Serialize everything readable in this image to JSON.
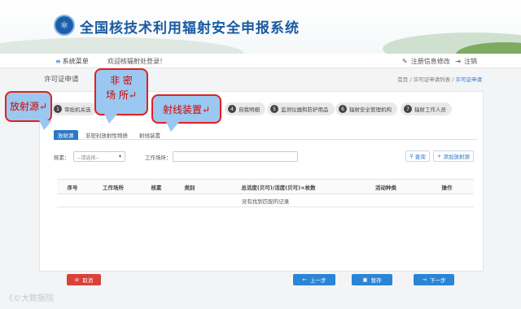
{
  "header": {
    "app_title": "全国核技术利用辐射安全申报系统",
    "logo_glyph": "⚛"
  },
  "topbar": {
    "menu_icon": "≡",
    "menu_label": "系统菜单",
    "welcome": "欢迎核辐射处登录！",
    "edit_icon": "✎",
    "edit_label": "注册信息修改",
    "logout_icon": "⇥",
    "logout_label": "注销"
  },
  "page": {
    "title": "许可证申请",
    "breadcrumb": [
      "首页",
      "/",
      "许可证申请列表",
      "/",
      "许可证申请"
    ]
  },
  "steps": [
    {
      "num": "1",
      "label": "审批机关选"
    },
    {
      "num": "4",
      "label": "自我明细"
    },
    {
      "num": "5",
      "label": "监测仪器和防护用品"
    },
    {
      "num": "6",
      "label": "辐射安全管理机构"
    },
    {
      "num": "7",
      "label": "辐射工作人员"
    }
  ],
  "subtabs": [
    {
      "label": "放射源"
    },
    {
      "label": "非密封放射性物质"
    },
    {
      "label": "射线装置"
    }
  ],
  "filters": {
    "nuclide_label": "核素：",
    "nuclide_placeholder": "--请选择--",
    "workplace_label": "工作场所：",
    "workplace_value": "",
    "search_label": "查询",
    "add_label": "添加放射源"
  },
  "table": {
    "columns": [
      "序号",
      "工作场所",
      "核素",
      "类别",
      "总活度(贝可)/活度(贝可)×枚数",
      "活动种类",
      "操作"
    ],
    "empty_message": "没有找到匹配的记录"
  },
  "bottom": {
    "cancel": "取消",
    "prev": "上一步",
    "save": "暂存",
    "next": "下一步"
  },
  "callouts": {
    "radioactive_source": "放射源↵",
    "non_sealed_line1": "非  密",
    "non_sealed_line2": "场 所↵",
    "ray_device": "射线装置↵"
  },
  "watermark": "《©大数据院"
}
